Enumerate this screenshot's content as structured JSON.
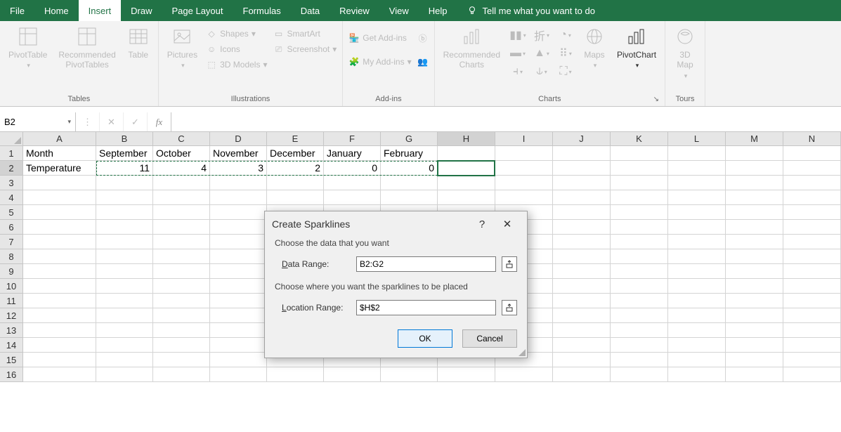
{
  "menu": {
    "items": [
      "File",
      "Home",
      "Insert",
      "Draw",
      "Page Layout",
      "Formulas",
      "Data",
      "Review",
      "View",
      "Help"
    ],
    "activeIndex": 2,
    "tellMe": "Tell me what you want to do"
  },
  "ribbon": {
    "groups": {
      "tables": {
        "label": "Tables",
        "pivotTable": "PivotTable",
        "recommendedPivot": "Recommended\nPivotTables",
        "table": "Table"
      },
      "illustrations": {
        "label": "Illustrations",
        "pictures": "Pictures",
        "shapes": "Shapes",
        "icons": "Icons",
        "models3d": "3D Models",
        "smartArt": "SmartArt",
        "screenshot": "Screenshot"
      },
      "addins": {
        "label": "Add-ins",
        "getAddins": "Get Add-ins",
        "myAddins": "My Add-ins"
      },
      "charts": {
        "label": "Charts",
        "recommended": "Recommended\nCharts",
        "maps": "Maps",
        "pivotChart": "PivotChart"
      },
      "tours": {
        "label": "Tours",
        "map3d": "3D\nMap"
      }
    }
  },
  "nameBox": "B2",
  "formula": "",
  "columns": [
    "A",
    "B",
    "C",
    "D",
    "E",
    "F",
    "G",
    "H",
    "I",
    "J",
    "K",
    "L",
    "M",
    "N"
  ],
  "rowCount": 16,
  "data": {
    "r1": {
      "A": "Month",
      "B": "September",
      "C": "October",
      "D": "November",
      "E": "December",
      "F": "January",
      "G": "February"
    },
    "r2": {
      "A": "Temperature",
      "B": "11",
      "C": "4",
      "D": "3",
      "E": "2",
      "F": "0",
      "G": "0"
    }
  },
  "dialog": {
    "title": "Create Sparklines",
    "section1": "Choose the data that you want",
    "dataRangeLabel": "Data Range:",
    "dataRangeValue": "B2:G2",
    "section2": "Choose where you want the sparklines to be placed",
    "locationRangeLabel": "Location Range:",
    "locationRangeValue": "$H$2",
    "ok": "OK",
    "cancel": "Cancel",
    "help": "?",
    "close": "✕"
  }
}
